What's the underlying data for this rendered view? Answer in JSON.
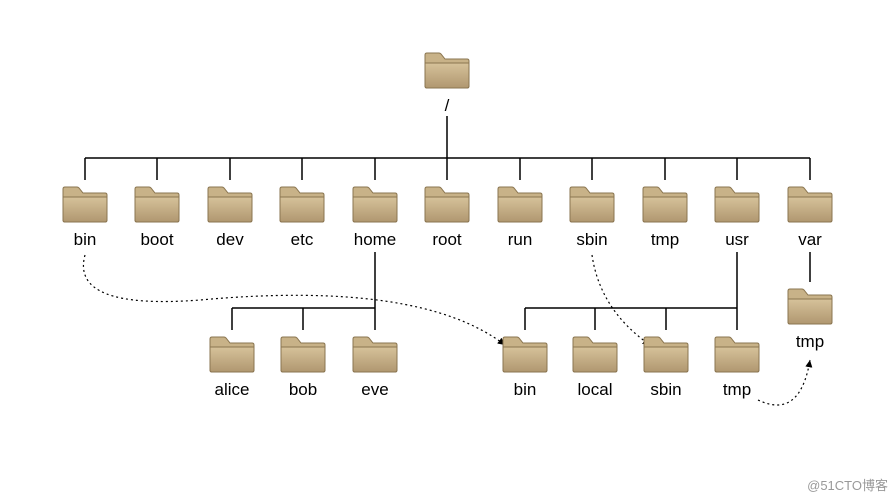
{
  "root": {
    "label": "/"
  },
  "level1": [
    {
      "key": "bin",
      "label": "bin"
    },
    {
      "key": "boot",
      "label": "boot"
    },
    {
      "key": "dev",
      "label": "dev"
    },
    {
      "key": "etc",
      "label": "etc"
    },
    {
      "key": "home",
      "label": "home"
    },
    {
      "key": "root",
      "label": "root"
    },
    {
      "key": "run",
      "label": "run"
    },
    {
      "key": "sbin",
      "label": "sbin"
    },
    {
      "key": "tmp",
      "label": "tmp"
    },
    {
      "key": "usr",
      "label": "usr"
    },
    {
      "key": "var",
      "label": "var"
    }
  ],
  "home_children": [
    {
      "key": "alice",
      "label": "alice"
    },
    {
      "key": "bob",
      "label": "bob"
    },
    {
      "key": "eve",
      "label": "eve"
    }
  ],
  "usr_children": [
    {
      "key": "usr_bin",
      "label": "bin"
    },
    {
      "key": "usr_local",
      "label": "local"
    },
    {
      "key": "usr_sbin",
      "label": "sbin"
    },
    {
      "key": "usr_tmp",
      "label": "tmp"
    }
  ],
  "var_children": [
    {
      "key": "var_tmp",
      "label": "tmp"
    }
  ],
  "dotted_arrows": [
    {
      "from": "bin",
      "to": "usr_bin"
    },
    {
      "from": "sbin",
      "to": "usr_sbin"
    },
    {
      "from": "tmp",
      "to": "var_tmp"
    }
  ],
  "watermark": "@51CTO博客"
}
